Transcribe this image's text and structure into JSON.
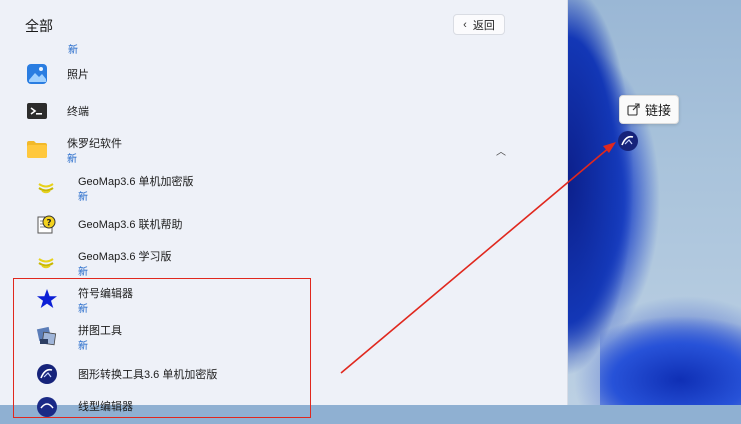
{
  "panel": {
    "title": "全部",
    "back_label": "返回",
    "stray_badge": "新"
  },
  "apps": [
    {
      "name": "照片",
      "badge": "",
      "icon": "photos-icon"
    },
    {
      "name": "终端",
      "badge": "",
      "icon": "terminal-icon"
    },
    {
      "name": "侏罗纪软件",
      "badge": "新",
      "icon": "folder-icon"
    },
    {
      "name": "GeoMap3.6 单机加密版",
      "badge": "新",
      "icon": "geomap-icon"
    },
    {
      "name": "GeoMap3.6 联机帮助",
      "badge": "",
      "icon": "help-file-icon"
    },
    {
      "name": "GeoMap3.6 学习版",
      "badge": "新",
      "icon": "geomap-icon"
    },
    {
      "name": "符号编辑器",
      "badge": "新",
      "icon": "blue-star-icon"
    },
    {
      "name": "拼图工具",
      "badge": "新",
      "icon": "puzzle-tool-icon"
    },
    {
      "name": "图形转换工具3.6 单机加密版",
      "badge": "",
      "icon": "graphic-convert-icon"
    },
    {
      "name": "线型编辑器",
      "badge": "",
      "icon": "line-editor-icon"
    }
  ],
  "drag_tooltip": {
    "label": "链接",
    "icon": "external-link-icon"
  },
  "colors": {
    "panel_bg": "#eef1f8",
    "accent_new": "#1a63c8",
    "highlight": "#e0281e"
  }
}
